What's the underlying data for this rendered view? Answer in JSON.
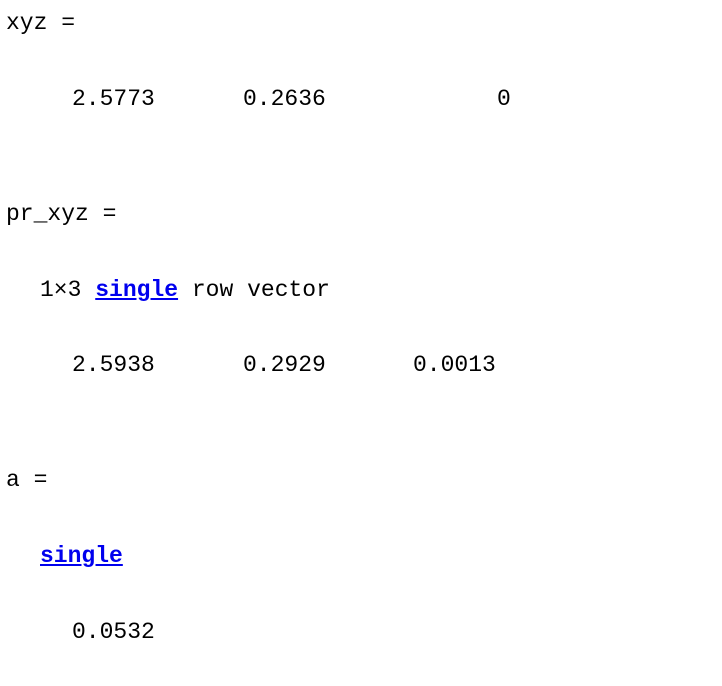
{
  "console": {
    "block1": {
      "header": "xyz =",
      "values": [
        "2.5773",
        "0.2636",
        "0"
      ]
    },
    "block2": {
      "header": "pr_xyz =",
      "size_text": "1×3",
      "class_link": "single",
      "type_text": "row vector",
      "values": [
        "2.5938",
        "0.2929",
        "0.0013"
      ]
    },
    "block3": {
      "header": "a =",
      "class_link": "single",
      "value": "0.0532"
    }
  },
  "colors": {
    "link": "#0000ee",
    "text": "#000000",
    "background": "#ffffff"
  }
}
